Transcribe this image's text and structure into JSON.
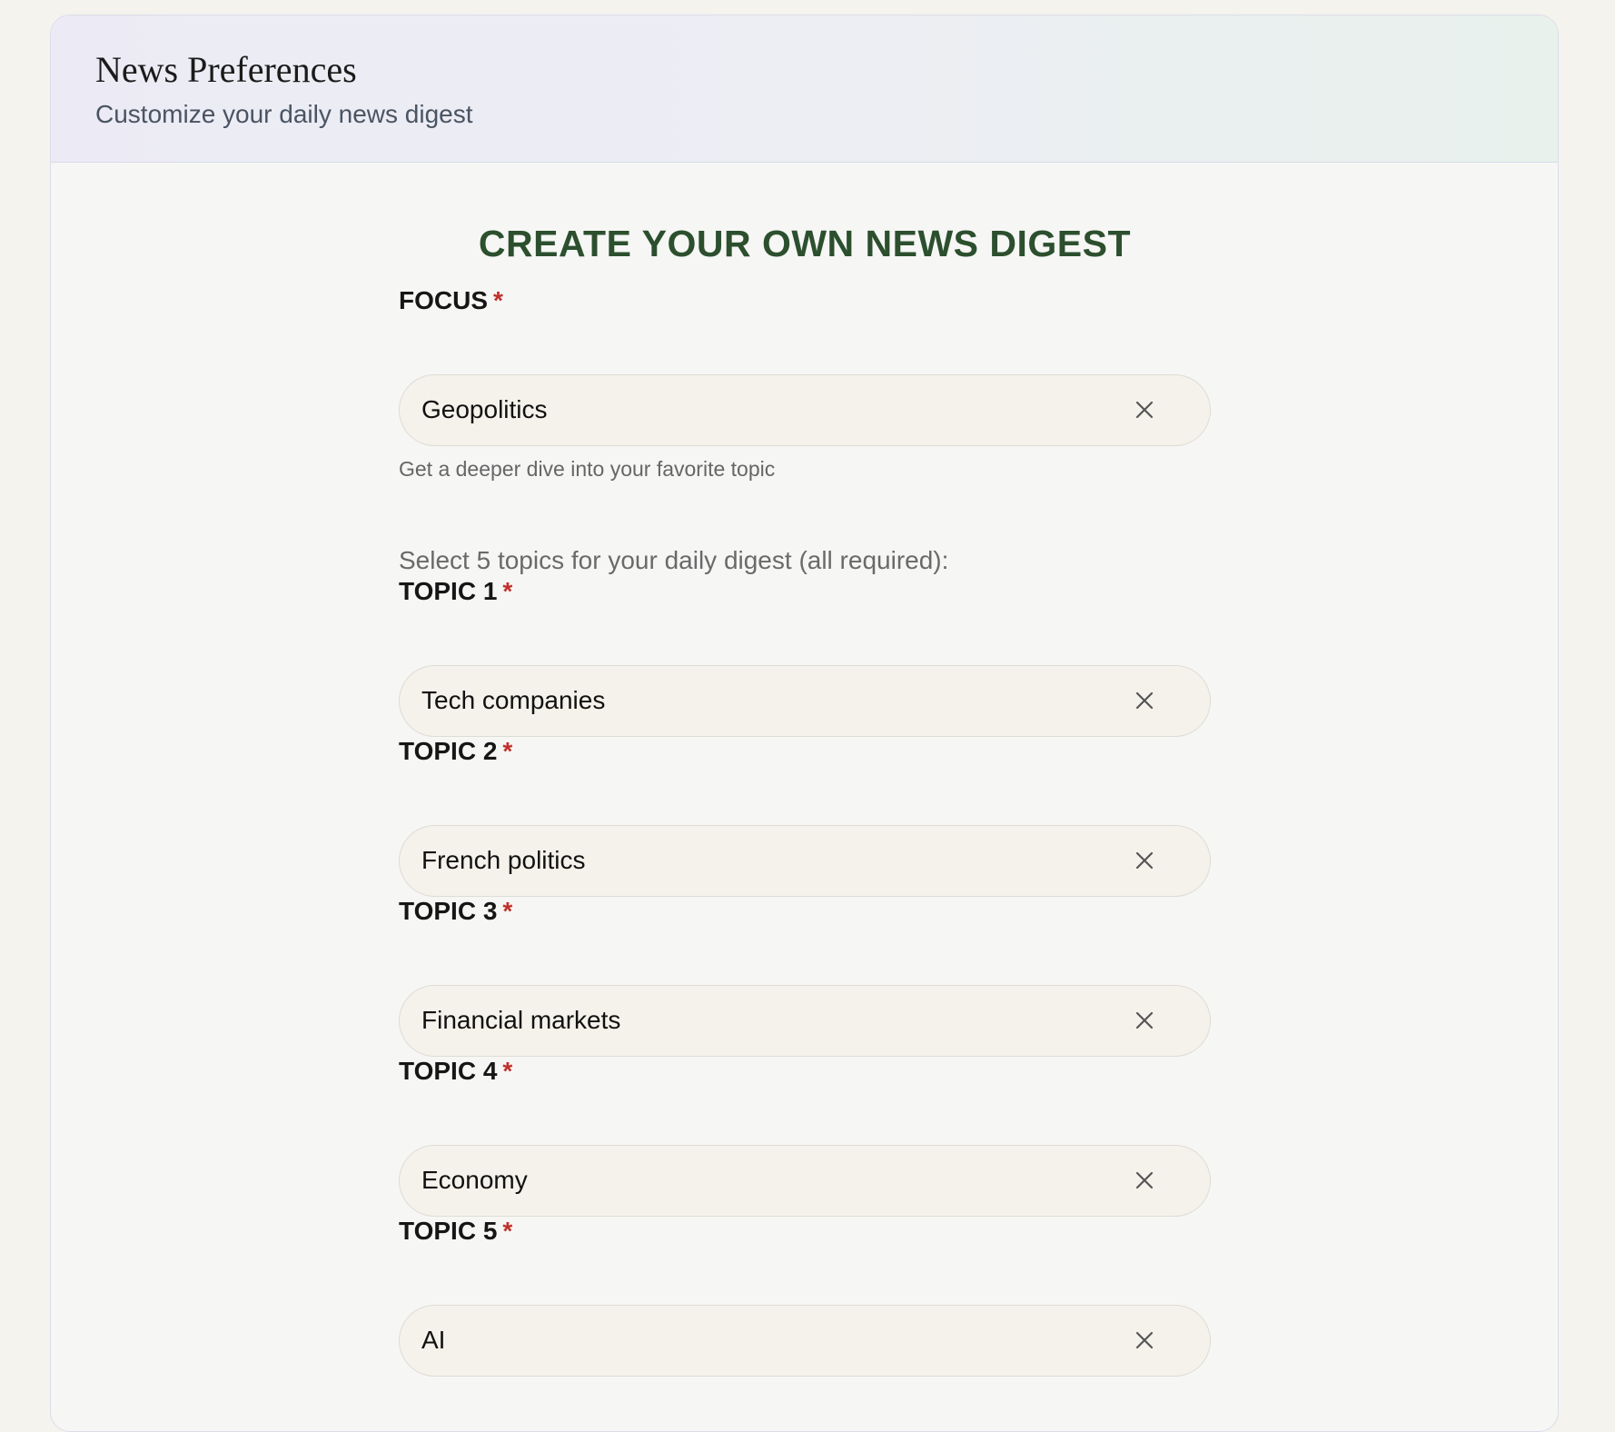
{
  "header": {
    "title": "News Preferences",
    "subtitle": "Customize your daily news digest"
  },
  "form": {
    "heading": "CREATE YOUR OWN NEWS DIGEST",
    "required_marker": "*",
    "focus": {
      "label": "FOCUS",
      "value": "Geopolitics",
      "helper": "Get a deeper dive into your favorite topic"
    },
    "instruction": "Select 5 topics for your daily digest (all required):",
    "topics": [
      {
        "label": "TOPIC 1",
        "value": "Tech companies"
      },
      {
        "label": "TOPIC 2",
        "value": "French politics"
      },
      {
        "label": "TOPIC 3",
        "value": "Financial markets"
      },
      {
        "label": "TOPIC 4",
        "value": "Economy"
      },
      {
        "label": "TOPIC 5",
        "value": "AI"
      }
    ],
    "clear_icon": "close-icon"
  },
  "colors": {
    "heading": "#2c4f2e",
    "required": "#c0302a",
    "pill_background": "#f4f2ea"
  }
}
